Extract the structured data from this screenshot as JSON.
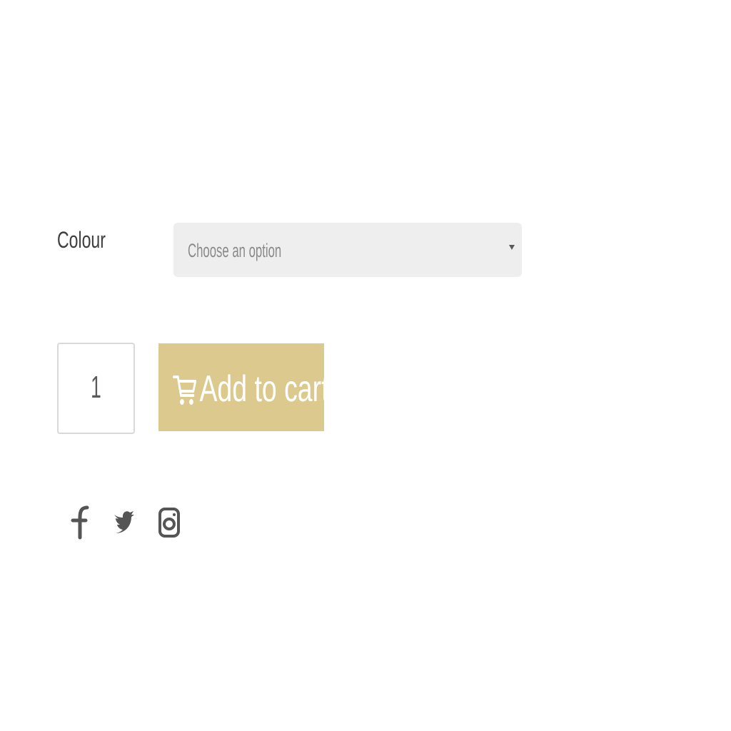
{
  "variations": {
    "colour": {
      "label": "Colour",
      "selected_option": "Choose an option"
    }
  },
  "cart": {
    "quantity": "1",
    "add_to_cart_label": "Add to cart",
    "button_color": "#dcc98e",
    "icon": "cart-icon"
  },
  "share": {
    "icons": [
      "facebook-icon",
      "twitter-icon",
      "instagram-icon"
    ],
    "icon_color": "#555555"
  }
}
